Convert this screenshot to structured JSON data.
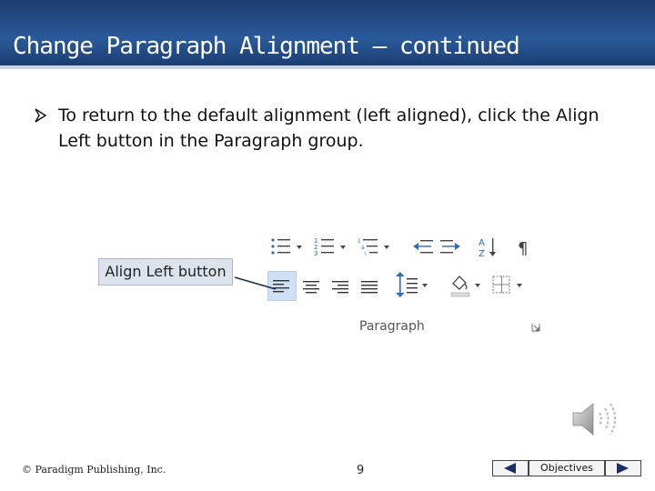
{
  "slide": {
    "title": "Change Paragraph Alignment – continued",
    "bullet": "To return to the default alignment (left aligned), click the Align Left button in the Paragraph group.",
    "callout_label": "Align Left button"
  },
  "ribbon": {
    "group_label": "Paragraph",
    "row1_icons": [
      "bullets-icon",
      "numbering-icon",
      "multilevel-list-icon",
      "decrease-indent-icon",
      "increase-indent-icon",
      "sort-icon",
      "show-formatting-icon"
    ],
    "row2_icons": [
      "align-left-icon",
      "center-icon",
      "align-right-icon",
      "justify-icon",
      "line-spacing-icon",
      "shading-icon",
      "borders-icon"
    ],
    "selected": "align-left-icon"
  },
  "footer": {
    "copyright": "© Paradigm Publishing, Inc.",
    "page_number": "9",
    "objectives_label": "Objectives"
  },
  "colors": {
    "title_bar": "#1d3c6e",
    "callout_bg": "#dde3ed",
    "selected_button": "#cfe0f4",
    "icon_blue": "#2f6db5"
  }
}
